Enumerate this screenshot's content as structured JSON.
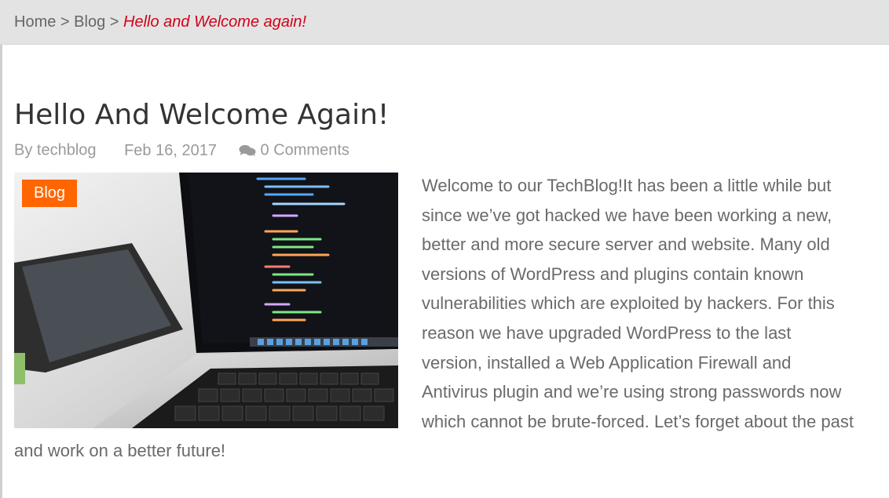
{
  "breadcrumb": {
    "home": "Home",
    "separator": ">",
    "blog": "Blog",
    "current": "Hello and Welcome again!"
  },
  "post": {
    "title": "Hello And Welcome Again!",
    "author": "By techblog",
    "date": "Feb 16, 2017",
    "comments": "0 Comments",
    "category": "Blog",
    "body": "Welcome to our TechBlog!It has been a little while but since we’ve got hacked we have been working a new, better and more secure server and website. Many old versions of WordPress and plugins contain known vulnerabilities which are exploited by hackers. For this reason we have upgraded WordPress to the last version, installed a Web Application Firewall and Antivirus plugin and we’re using strong passwords now which cannot be brute-forced. Let’s forget about the past and work on a better future!"
  },
  "colors": {
    "accent_current": "#d0021b",
    "badge": "#ff6600",
    "breadcrumb_bg": "#e3e3e3"
  },
  "icons": {
    "comments": "comments-icon",
    "feature_image": "laptop-code-photo"
  }
}
